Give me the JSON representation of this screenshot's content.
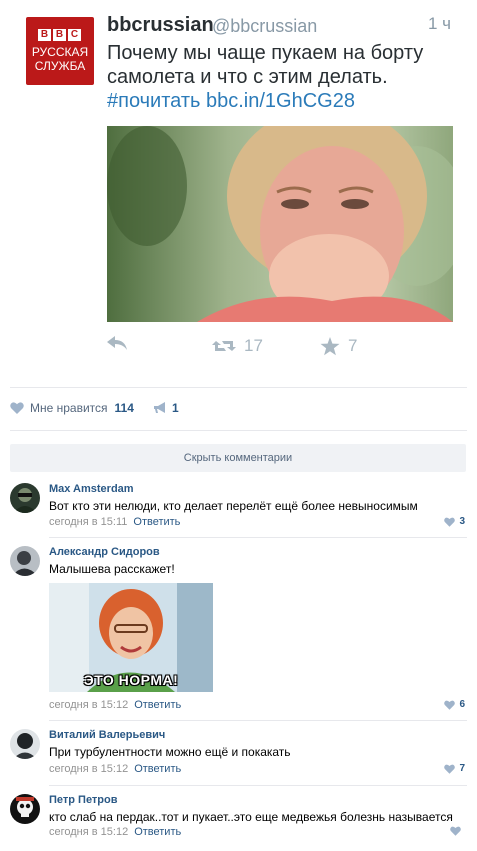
{
  "tweet": {
    "logo_top": "BBC",
    "logo_line1": "РУССКАЯ",
    "logo_line2": "СЛУЖБА",
    "name": "bbcrussian",
    "handle": "@bbcrussian",
    "time": "1 ч",
    "text_line1": "Почему мы чаще пукаем на борту",
    "text_line2": "самолета и что с этим делать.",
    "hashtag": "#почитать",
    "link": "bbc.in/1GhCG28",
    "retweets": "17",
    "favorites": "7",
    "icons": [
      "reply-icon",
      "retweet-icon",
      "star-icon"
    ]
  },
  "likes": {
    "label": "Мне нравится",
    "count": "114",
    "shares": "1",
    "icons": [
      "heart-icon",
      "megaphone-icon"
    ]
  },
  "hide_comments_label": "Скрыть комментарии",
  "comments": [
    {
      "author": "Max Amsterdam",
      "text": "Вот кто эти нелюди, кто делает перелёт ещё более невыносимым",
      "time": "сегодня в 15:11",
      "reply": "Ответить",
      "likes": "3"
    },
    {
      "author": "Александр Сидоров",
      "text": "Малышева расскажет!",
      "image_caption": "ЭТО НОРМА!",
      "time": "сегодня в 15:12",
      "reply": "Ответить",
      "likes": "6"
    },
    {
      "author": "Виталий Валерьевич",
      "text": "При турбулентности можно ещё и покакать",
      "time": "сегодня в 15:12",
      "reply": "Ответить",
      "likes": "7"
    },
    {
      "author": "Петр Петров",
      "text": "кто слаб на пердак..тот и пукает..это еще медвежья болезнь называется",
      "time": "сегодня в 15:12",
      "reply": "Ответить",
      "likes": ""
    }
  ],
  "colors": {
    "vk_link": "#2a5885",
    "twitter_link": "#2b7bb9",
    "bbc_red": "#bb1919",
    "meta_gray": "#939393"
  }
}
